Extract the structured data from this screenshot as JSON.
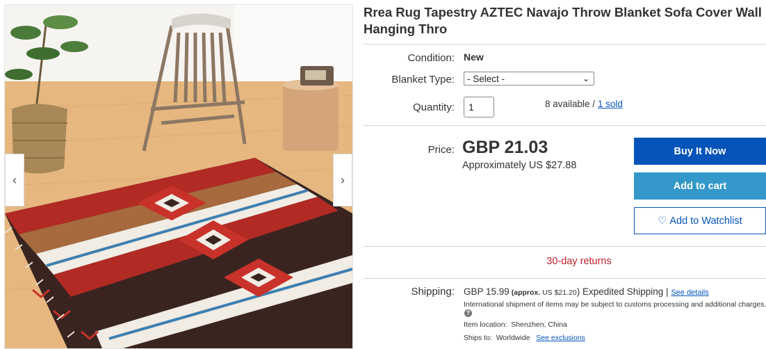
{
  "listing": {
    "title": "Rrea Rug Tapestry AZTEC Navajo Throw Blanket Sofa Cover Wall Hanging Thro"
  },
  "gallery": {
    "image_label": "product-photo-aztec-rug",
    "prev_glyph": "‹",
    "next_glyph": "›"
  },
  "condition": {
    "label": "Condition:",
    "value": "New"
  },
  "blanket_type": {
    "label": "Blanket Type:",
    "selected": "- Select -",
    "chevron": "⌄"
  },
  "quantity": {
    "label": "Quantity:",
    "value": "1",
    "available": "8 available",
    "separator": " / ",
    "sold_link": "1 sold"
  },
  "price": {
    "label": "Price:",
    "value": "GBP 21.03",
    "approx_prefix": "Approximately ",
    "approx_value": "US $27.88"
  },
  "actions": {
    "buy_now": "Buy It Now",
    "add_to_cart": "Add to cart",
    "watchlist": "Add to Watchlist",
    "watchlist_icon": "♡"
  },
  "returns": {
    "text": "30-day returns"
  },
  "shipping": {
    "label": "Shipping:",
    "cost": "GBP 15.99",
    "approx_open": " (approx. ",
    "approx_value": "US $21.20",
    "approx_close": ") ",
    "service": "Expedited Shipping",
    "divider": " | ",
    "details_link": "See details",
    "help_glyph": "?",
    "intl_note": "International shipment of items may be subject to customs processing and additional charges.",
    "location_label": "Item location:",
    "location_value": "Shenzhen, China",
    "ships_to_label": "Ships to:",
    "ships_to_value": "Worldwide",
    "exclusions_link": "See exclusions"
  },
  "colors": {
    "buy_now_bg": "#0654ba",
    "add_to_cart_bg": "#3498ca",
    "returns_text": "#c0202e",
    "link": "#0654ba"
  }
}
